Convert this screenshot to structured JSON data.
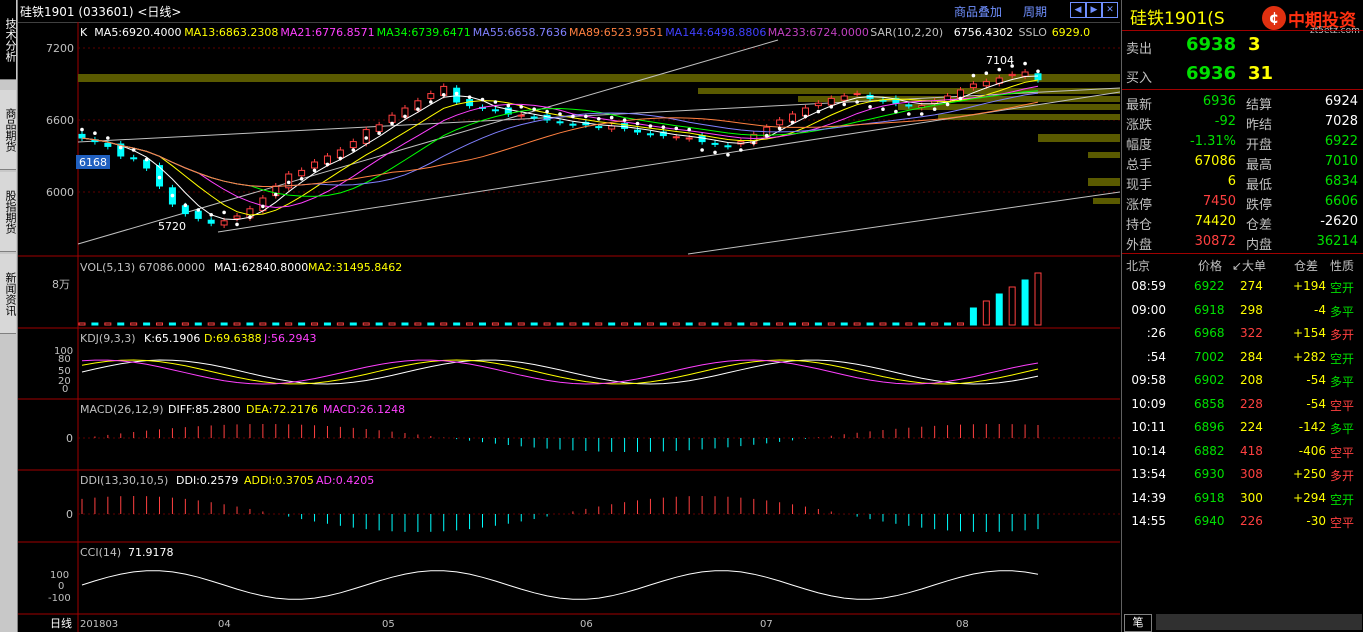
{
  "left_tabs": [
    "技术分析",
    "商品期货",
    "股指期货",
    "新闻资讯"
  ],
  "header": {
    "title": "硅铁1901 (033601) <日线>",
    "overlay_link": "商品叠加",
    "period_link": "周期",
    "nav_icons": [
      "arrow-left-icon",
      "arrow-right-icon",
      "close-icon"
    ]
  },
  "main_panel": {
    "legend": [
      {
        "text": "K",
        "color": "#ffffff"
      },
      {
        "text": "MA5:6920.4000",
        "color": "#ffffff"
      },
      {
        "text": "MA13:6863.2308",
        "color": "#ffff00"
      },
      {
        "text": "MA21:6776.8571",
        "color": "#ff40ff"
      },
      {
        "text": "MA34:6739.6471",
        "color": "#00ff00"
      },
      {
        "text": "MA55:6658.7636",
        "color": "#8080ff"
      },
      {
        "text": "MA89:6523.9551",
        "color": "#ff8040"
      },
      {
        "text": "MA144:6498.8806",
        "color": "#4040ff"
      },
      {
        "text": "MA233:6724.0000",
        "color": "#c040c0"
      },
      {
        "text": "SAR(10,2,20)",
        "color": "#c0c0c0"
      },
      {
        "text": "6756.4302",
        "color": "#ffffff"
      },
      {
        "text": "SSLO",
        "color": "#c0c0c0"
      },
      {
        "text": "6929.0",
        "color": "#ffff00"
      }
    ],
    "y_ticks": [
      "7200",
      "6600",
      "6000"
    ],
    "marker_high": "7104",
    "marker_low": "5720",
    "current_tag": "6168"
  },
  "vol_panel": {
    "legend": "VOL(5,13) 67086.0000",
    "ma1": "MA1:62840.8000",
    "ma2": "MA2:31495.8462",
    "y_tick": "8万"
  },
  "kdj_panel": {
    "legend": "KDJ(9,3,3)",
    "k": "K:65.1906",
    "d": "D:69.6388",
    "j": "J:56.2943",
    "y_ticks": [
      "100",
      "80",
      "50",
      "20",
      "0"
    ]
  },
  "macd_panel": {
    "legend": "MACD(26,12,9)",
    "diff": "DIFF:85.2800",
    "dea": "DEA:72.2176",
    "macd": "MACD:26.1248",
    "y_tick": "0"
  },
  "ddi_panel": {
    "legend": "DDI(13,30,10,5)",
    "ddi": "DDI:0.2579",
    "addi": "ADDI:0.3705",
    "ad": "AD:0.4205",
    "y_tick": "0"
  },
  "cci_panel": {
    "legend": "CCI(14)",
    "value": "71.9178",
    "y_ticks": [
      "100",
      "0",
      "-100"
    ]
  },
  "x_axis": {
    "period": "日线",
    "labels": [
      "201803",
      "04",
      "05",
      "06",
      "07",
      "08"
    ]
  },
  "right_panel": {
    "title": "硅铁1901(S",
    "logo_text": "中期投资",
    "logo_url": "zt5etz.com",
    "sell": {
      "label": "卖出",
      "price": "6938",
      "qty": "3"
    },
    "buy": {
      "label": "买入",
      "price": "6936",
      "qty": "31"
    },
    "stats": [
      {
        "l1": "最新",
        "v1": "6936",
        "c1": "green",
        "l2": "结算",
        "v2": "6924",
        "c2": "white"
      },
      {
        "l1": "涨跌",
        "v1": "-92",
        "c1": "green",
        "l2": "昨结",
        "v2": "7028",
        "c2": "white"
      },
      {
        "l1": "幅度",
        "v1": "-1.31%",
        "c1": "green",
        "l2": "开盘",
        "v2": "6922",
        "c2": "green"
      },
      {
        "l1": "总手",
        "v1": "67086",
        "c1": "yellow",
        "l2": "最高",
        "v2": "7010",
        "c2": "green"
      },
      {
        "l1": "现手",
        "v1": "6",
        "c1": "yellow",
        "l2": "最低",
        "v2": "6834",
        "c2": "green"
      },
      {
        "l1": "涨停",
        "v1": "7450",
        "c1": "red",
        "l2": "跌停",
        "v2": "6606",
        "c2": "green"
      },
      {
        "l1": "持仓",
        "v1": "74420",
        "c1": "yellow",
        "l2": "仓差",
        "v2": "-2620",
        "c2": "white"
      },
      {
        "l1": "外盘",
        "v1": "30872",
        "c1": "red",
        "l2": "内盘",
        "v2": "36214",
        "c2": "green"
      }
    ],
    "ticks_header": [
      "北京",
      "价格",
      "↙大单",
      "仓差",
      "性质"
    ],
    "ticks": [
      {
        "time": "08:59",
        "price": "6922",
        "pc": "green",
        "vol": "274",
        "vc": "yellow",
        "diff": "+194",
        "dc": "yellow",
        "nature": "空开",
        "nc": "green"
      },
      {
        "time": "09:00",
        "price": "6918",
        "pc": "green",
        "vol": "298",
        "vc": "yellow",
        "diff": "-4",
        "dc": "yellow",
        "nature": "多平",
        "nc": "green"
      },
      {
        "time": ":26",
        "price": "6968",
        "pc": "green",
        "vol": "322",
        "vc": "red",
        "diff": "+154",
        "dc": "yellow",
        "nature": "多开",
        "nc": "red"
      },
      {
        "time": ":54",
        "price": "7002",
        "pc": "green",
        "vol": "284",
        "vc": "yellow",
        "diff": "+282",
        "dc": "yellow",
        "nature": "空开",
        "nc": "green"
      },
      {
        "time": "09:58",
        "price": "6902",
        "pc": "green",
        "vol": "208",
        "vc": "yellow",
        "diff": "-54",
        "dc": "yellow",
        "nature": "多平",
        "nc": "green"
      },
      {
        "time": "10:09",
        "price": "6858",
        "pc": "green",
        "vol": "228",
        "vc": "red",
        "diff": "-54",
        "dc": "yellow",
        "nature": "空平",
        "nc": "red"
      },
      {
        "time": "10:11",
        "price": "6896",
        "pc": "green",
        "vol": "224",
        "vc": "yellow",
        "diff": "-142",
        "dc": "yellow",
        "nature": "多平",
        "nc": "green"
      },
      {
        "time": "10:14",
        "price": "6882",
        "pc": "green",
        "vol": "418",
        "vc": "red",
        "diff": "-406",
        "dc": "yellow",
        "nature": "空平",
        "nc": "red"
      },
      {
        "time": "13:54",
        "price": "6930",
        "pc": "green",
        "vol": "308",
        "vc": "red",
        "diff": "+250",
        "dc": "yellow",
        "nature": "多开",
        "nc": "red"
      },
      {
        "time": "14:39",
        "price": "6918",
        "pc": "green",
        "vol": "300",
        "vc": "yellow",
        "diff": "+294",
        "dc": "yellow",
        "nature": "空开",
        "nc": "green"
      },
      {
        "time": "14:55",
        "price": "6940",
        "pc": "green",
        "vol": "226",
        "vc": "red",
        "diff": "-30",
        "dc": "yellow",
        "nature": "空平",
        "nc": "red"
      }
    ],
    "bottom_tab": "笔"
  },
  "chart_data": {
    "type": "candlestick",
    "ylim": [
      5500,
      7350
    ],
    "close_series": [
      6450,
      6420,
      6380,
      6300,
      6280,
      6200,
      6050,
      5900,
      5820,
      5780,
      5740,
      5760,
      5800,
      5860,
      5950,
      6050,
      6150,
      6180,
      6250,
      6300,
      6350,
      6420,
      6520,
      6560,
      6640,
      6700,
      6760,
      6820,
      6880,
      6750,
      6720,
      6700,
      6680,
      6650,
      6640,
      6620,
      6600,
      6580,
      6560,
      6560,
      6540,
      6550,
      6530,
      6500,
      6480,
      6470,
      6460,
      6450,
      6420,
      6400,
      6380,
      6420,
      6480,
      6540,
      6600,
      6650,
      6700,
      6740,
      6780,
      6800,
      6820,
      6780,
      6760,
      6740,
      6720,
      6720,
      6760,
      6800,
      6850,
      6900,
      6920,
      6950,
      6980,
      7000,
      6936
    ]
  }
}
